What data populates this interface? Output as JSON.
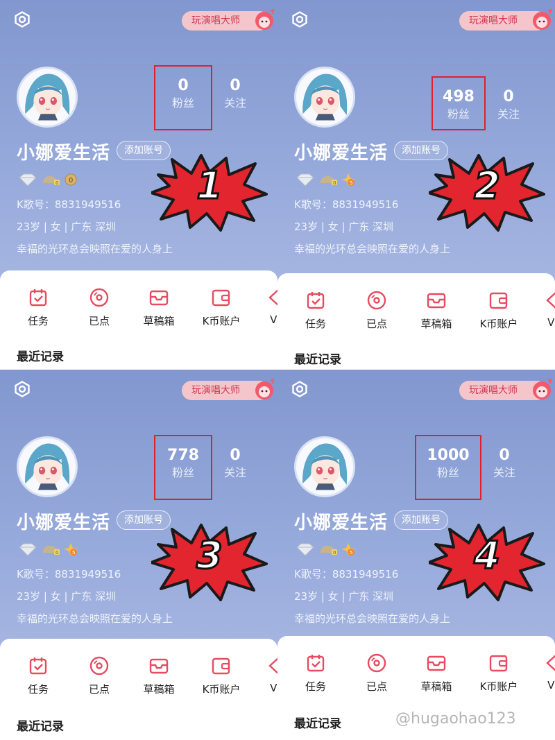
{
  "master_label": "玩演唱大师",
  "nickname": "小娜爱生活",
  "add_account": "添加账号",
  "k_id": "K歌号：8831949516",
  "demographics": "23岁 | 女 | 广东 深圳",
  "bio": "幸福的光环总会映照在爱的人身上",
  "fans_label": "粉丝",
  "following_label": "关注",
  "following_count": "0",
  "tabs": [
    "任务",
    "已点",
    "草稿箱",
    "K币账户",
    "VIP"
  ],
  "recent": "最近记录",
  "panels": [
    {
      "fans": "0",
      "step": "1",
      "coin_badge": "0"
    },
    {
      "fans": "498",
      "step": "2",
      "coin_badge": "5"
    },
    {
      "fans": "778",
      "step": "3",
      "coin_badge": "5"
    },
    {
      "fans": "1000",
      "step": "4",
      "coin_badge": "5"
    }
  ],
  "watermark": "@hugaohao123",
  "colors": {
    "accent": "#e0212b",
    "brand": "#e84a5f",
    "header_bg": "#93a7da"
  }
}
